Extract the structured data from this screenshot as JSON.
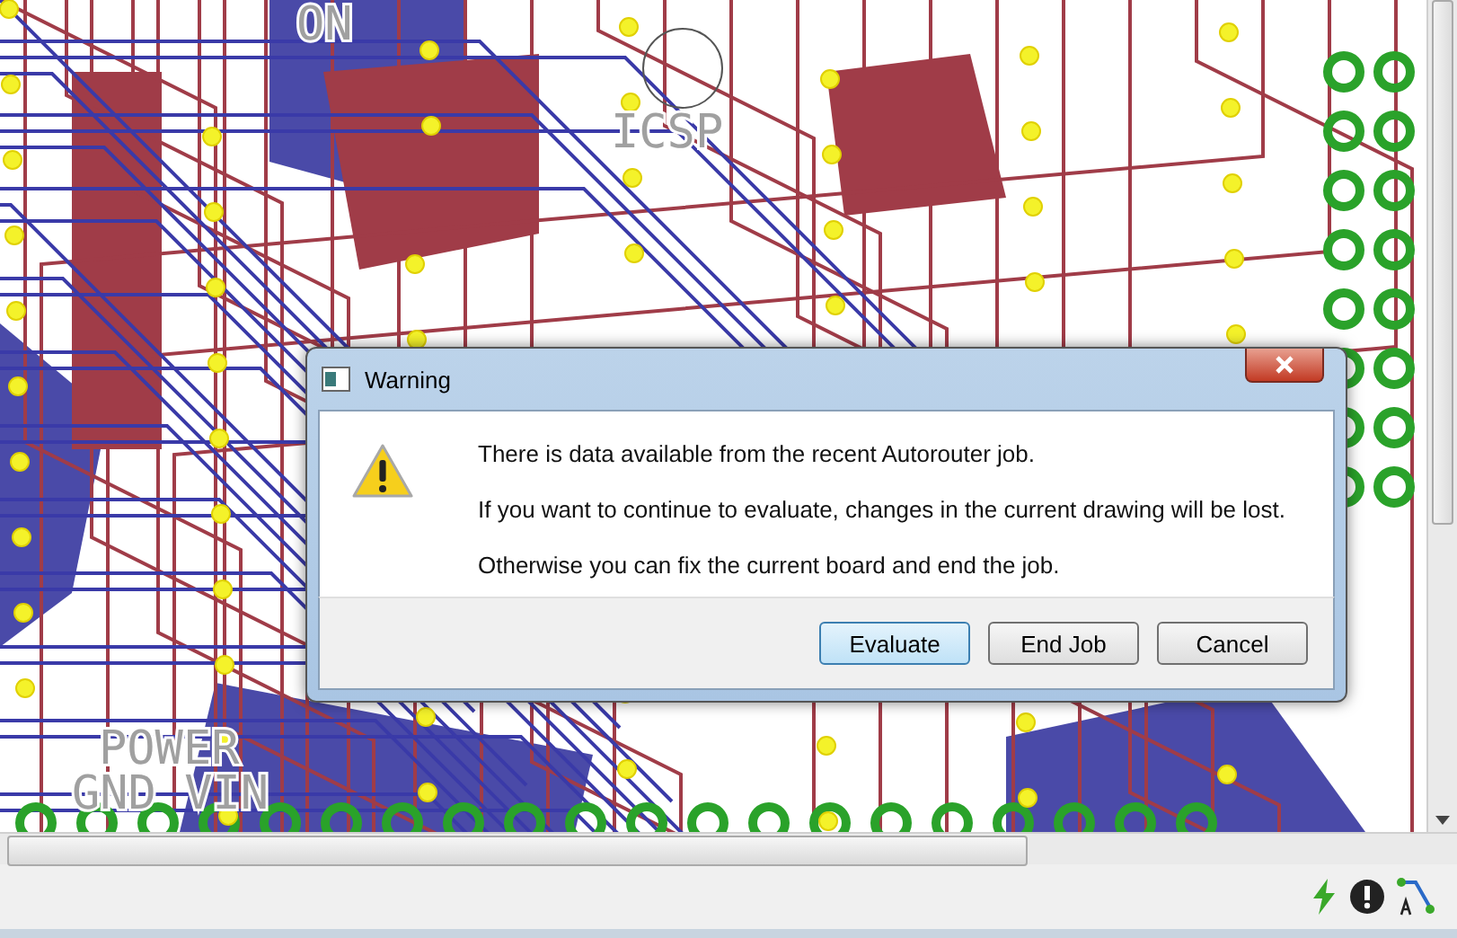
{
  "board": {
    "labels": [
      "ON",
      "ICSP",
      "POWER",
      "GND VIN"
    ]
  },
  "dialog": {
    "title": "Warning",
    "messages": [
      "There is data available from the recent Autorouter job.",
      "If you want to continue to evaluate, changes in the current drawing will be lost.",
      "Otherwise you can fix the current board and end the job."
    ],
    "buttons": [
      {
        "label": "Evaluate",
        "default": true
      },
      {
        "label": "End Job",
        "default": false
      },
      {
        "label": "Cancel",
        "default": false
      }
    ]
  }
}
